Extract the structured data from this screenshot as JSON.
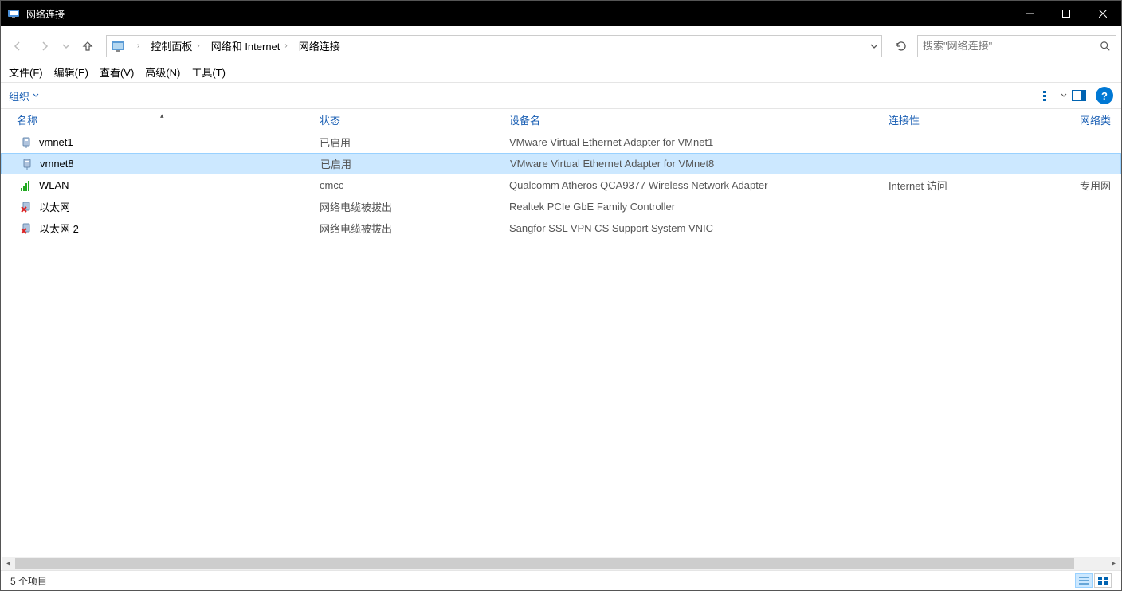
{
  "window": {
    "title": "网络连接"
  },
  "breadcrumb": {
    "items": [
      "控制面板",
      "网络和 Internet",
      "网络连接"
    ]
  },
  "search": {
    "placeholder": "搜索\"网络连接\""
  },
  "menu": {
    "file": "文件(F)",
    "edit": "编辑(E)",
    "view": "查看(V)",
    "advanced": "高级(N)",
    "tools": "工具(T)"
  },
  "toolbar": {
    "organize": "组织"
  },
  "columns": {
    "name": "名称",
    "status": "状态",
    "device": "设备名",
    "connectivity": "连接性",
    "type": "网络类"
  },
  "items": [
    {
      "name": "vmnet1",
      "status": "已启用",
      "device": "VMware Virtual Ethernet Adapter for VMnet1",
      "conn": "",
      "type": "",
      "icon": "adapter"
    },
    {
      "name": "vmnet8",
      "status": "已启用",
      "device": "VMware Virtual Ethernet Adapter for VMnet8",
      "conn": "",
      "type": "",
      "icon": "adapter",
      "selected": true
    },
    {
      "name": "WLAN",
      "status": "cmcc",
      "device": "Qualcomm Atheros QCA9377 Wireless Network Adapter",
      "conn": "Internet 访问",
      "type": "专用网",
      "icon": "wifi"
    },
    {
      "name": "以太网",
      "status": "网络电缆被拔出",
      "device": "Realtek PCIe GbE Family Controller",
      "conn": "",
      "type": "",
      "icon": "disconnected"
    },
    {
      "name": "以太网 2",
      "status": "网络电缆被拔出",
      "device": "Sangfor SSL VPN CS Support System VNIC",
      "conn": "",
      "type": "",
      "icon": "disconnected"
    }
  ],
  "statusbar": {
    "text": "5 个项目"
  }
}
